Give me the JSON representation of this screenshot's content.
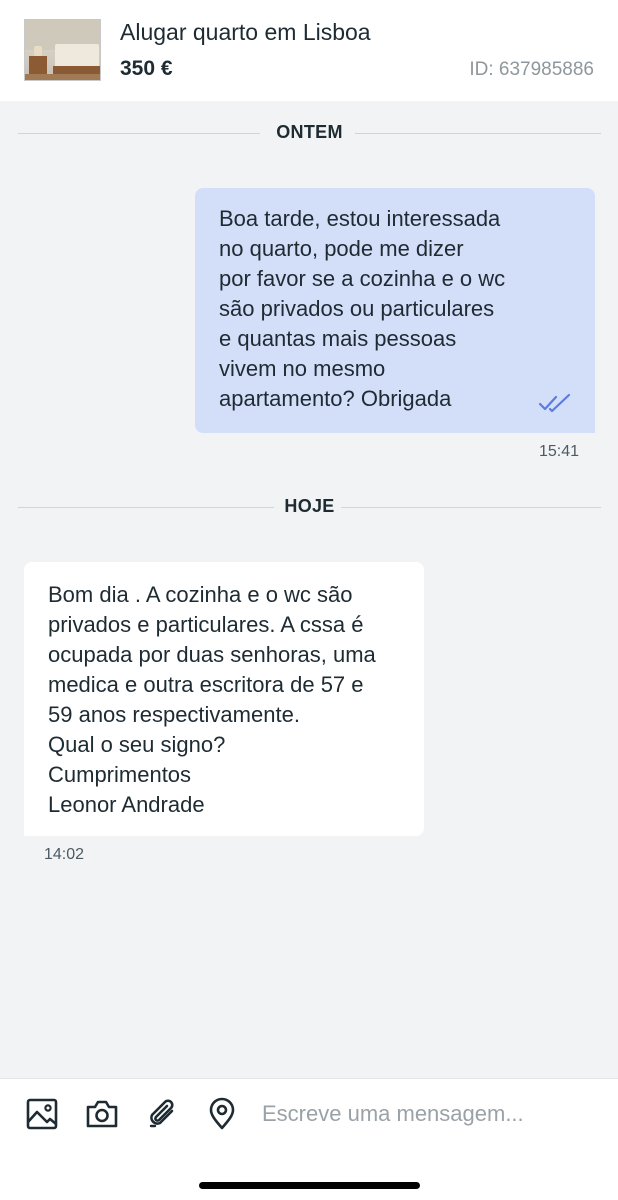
{
  "listing": {
    "title": "Alugar quarto em Lisboa",
    "price": "350 €",
    "id_text": "ID: 637985886",
    "thumbnail_icon": "bedroom-photo"
  },
  "separators": {
    "yesterday": "ONTEM",
    "today": "HOJE"
  },
  "messages": [
    {
      "direction": "outgoing",
      "lines": [
        "Boa tarde, estou interessada",
        "no quarto, pode me dizer",
        "por favor se a cozinha e o wc",
        "são privados ou particulares",
        "e quantas mais pessoas",
        "vivem no mesmo",
        "apartamento? Obrigada"
      ],
      "time": "15:41",
      "status_icon": "double-check-icon"
    },
    {
      "direction": "incoming",
      "lines": [
        "Bom dia . A cozinha e o wc são",
        "privados e particulares. A cssa é",
        "ocupada por duas senhoras, uma",
        "medica e outra escritora de 57 e",
        "59 anos respectivamente.",
        "Qual o seu signo?",
        "Cumprimentos",
        "Leonor Andrade"
      ],
      "time": "14:02"
    }
  ],
  "composer": {
    "placeholder": "Escreve uma mensagem...",
    "value": "",
    "tools": [
      "image-icon",
      "camera-icon",
      "paperclip-icon",
      "location-pin-icon"
    ]
  },
  "colors": {
    "outgoing_bubble": "#d3def9",
    "incoming_bubble": "#ffffff",
    "background": "#f2f3f5",
    "text": "#1e2b33",
    "tick": "#5b7be0"
  }
}
